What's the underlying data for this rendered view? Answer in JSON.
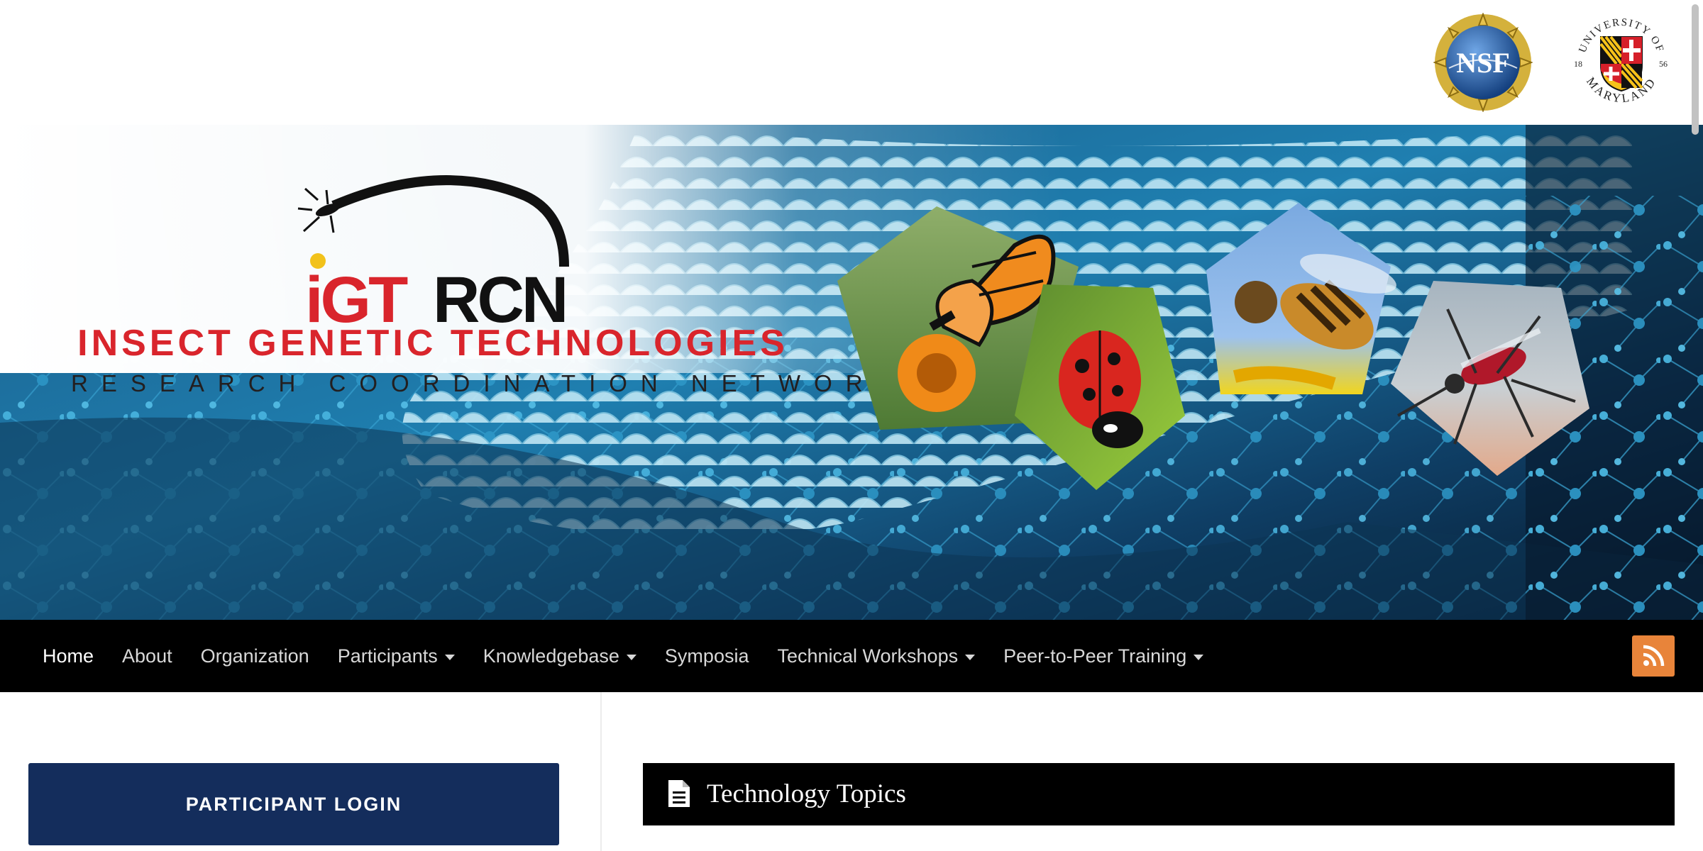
{
  "header": {
    "partner_logos": [
      {
        "name": "nsf-logo",
        "text": "NSF"
      },
      {
        "name": "umd-seal",
        "text": "UNIVERSITY OF MARYLAND",
        "years": [
          "18",
          "56"
        ]
      }
    ]
  },
  "banner": {
    "logo_mark": "iGTRCN",
    "logo_title": "INSECT GENETIC TECHNOLOGIES",
    "logo_subtitle": "RESEARCH COORDINATION NETWORK",
    "images": [
      "butterfly",
      "ladybug",
      "honeybee",
      "mosquito"
    ]
  },
  "nav": {
    "items": [
      {
        "label": "Home",
        "active": true,
        "dropdown": false
      },
      {
        "label": "About",
        "active": false,
        "dropdown": false
      },
      {
        "label": "Organization",
        "active": false,
        "dropdown": false
      },
      {
        "label": "Participants",
        "active": false,
        "dropdown": true
      },
      {
        "label": "Knowledgebase",
        "active": false,
        "dropdown": true
      },
      {
        "label": "Symposia",
        "active": false,
        "dropdown": false
      },
      {
        "label": "Technical Workshops",
        "active": false,
        "dropdown": true
      },
      {
        "label": "Peer-to-Peer Training",
        "active": false,
        "dropdown": true
      }
    ],
    "rss_icon": "rss-icon"
  },
  "sidebar": {
    "login_label": "PARTICIPANT LOGIN"
  },
  "main": {
    "section_title": "Technology Topics",
    "section_icon": "document-icon"
  },
  "colors": {
    "nav_background": "#000000",
    "login_button": "#142d5c",
    "rss_button": "#e8843a",
    "logo_red": "#d9252c"
  }
}
